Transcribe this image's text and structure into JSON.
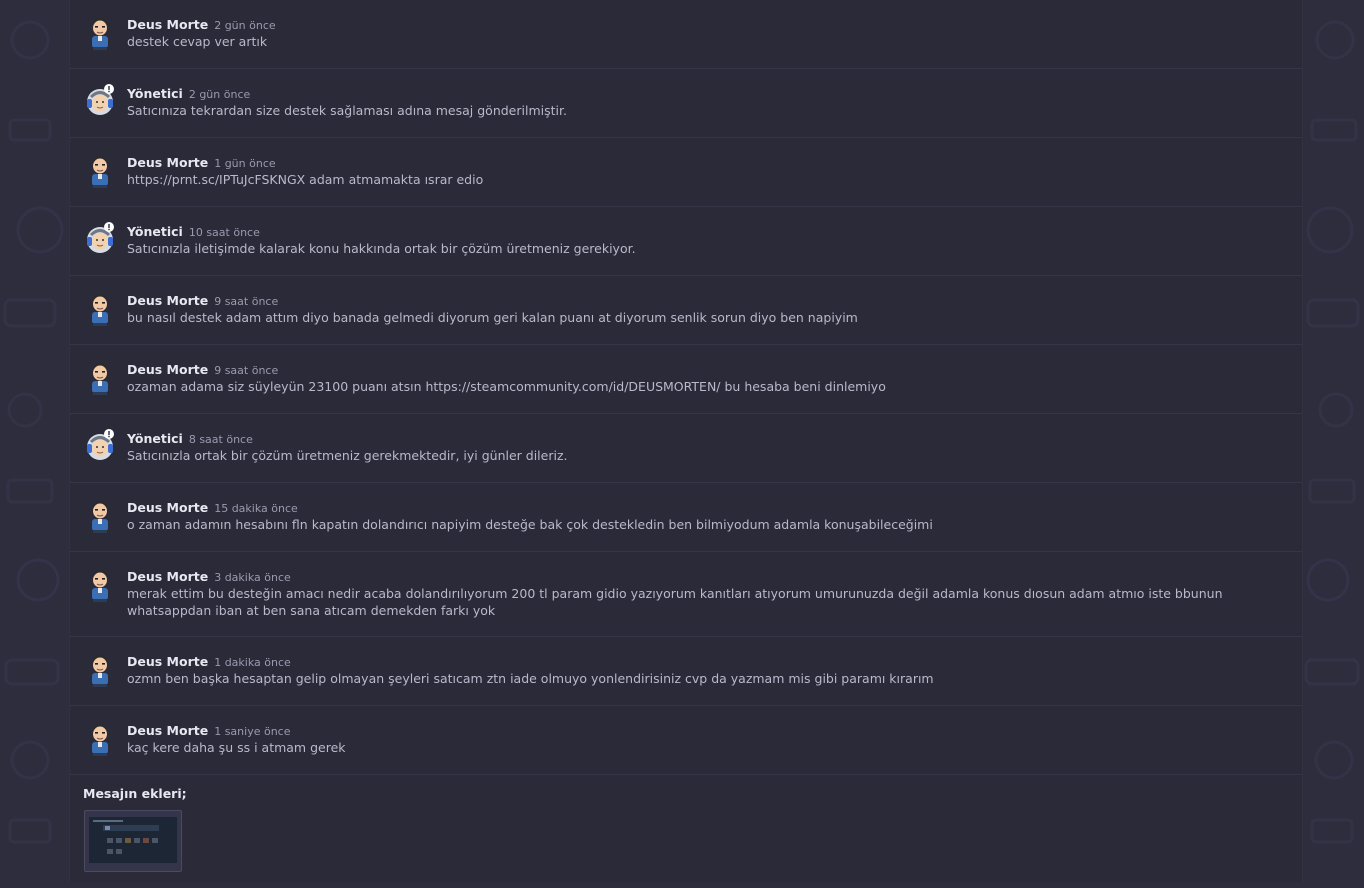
{
  "messages": [
    {
      "author": "Deus Morte",
      "time": "2 gün önce",
      "text": "destek cevap ver artık",
      "role": "user"
    },
    {
      "author": "Yönetici",
      "time": "2 gün önce",
      "text": "Satıcınıza tekrardan size destek sağlaması adına mesaj gönderilmiştir.",
      "role": "admin"
    },
    {
      "author": "Deus Morte",
      "time": "1 gün önce",
      "text": "https://prnt.sc/IPTuJcFSKNGX adam atmamakta ısrar edio",
      "role": "user"
    },
    {
      "author": "Yönetici",
      "time": "10 saat önce",
      "text": "Satıcınızla iletişimde kalarak konu hakkında ortak bir çözüm üretmeniz gerekiyor.",
      "role": "admin"
    },
    {
      "author": "Deus Morte",
      "time": "9 saat önce",
      "text": "bu nasıl destek adam attım diyo banada gelmedi diyorum geri kalan puanı at diyorum senlik sorun diyo ben napiyim",
      "role": "user"
    },
    {
      "author": "Deus Morte",
      "time": "9 saat önce",
      "text": "ozaman adama siz süyleyün 23100 puanı atsın https://steamcommunity.com/id/DEUSMORTEN/ bu hesaba beni dinlemiyo",
      "role": "user"
    },
    {
      "author": "Yönetici",
      "time": "8 saat önce",
      "text": "Satıcınızla ortak bir çözüm üretmeniz gerekmektedir, iyi günler dileriz.",
      "role": "admin"
    },
    {
      "author": "Deus Morte",
      "time": "15 dakika önce",
      "text": "o zaman adamın hesabını fln kapatın dolandırıcı napiyim desteğe bak çok destekledin ben bilmiyodum adamla konuşabileceğimi",
      "role": "user"
    },
    {
      "author": "Deus Morte",
      "time": "3 dakika önce",
      "text": "merak ettim bu desteğin amacı nedir acaba dolandırılıyorum 200 tl param gidio yazıyorum kanıtları atıyorum umurunuzda değil adamla konus dıosun adam atmıo iste bbunun whatsappdan iban at ben sana atıcam demekden farkı yok",
      "role": "user"
    },
    {
      "author": "Deus Morte",
      "time": "1 dakika önce",
      "text": "ozmn ben başka hesaptan gelip olmayan şeyleri satıcam ztn iade olmuyo yonlendirisiniz cvp da yazmam mis gibi paramı kırarım",
      "role": "user"
    },
    {
      "author": "Deus Morte",
      "time": "1 saniye önce",
      "text": "kaç kere daha şu ss i atmam gerek",
      "role": "user"
    }
  ],
  "attachments": {
    "title": "Mesajın ekleri;"
  },
  "colors": {
    "background": "#2d2d3d",
    "panel": "#2a2a38",
    "author": "#e8e8f2",
    "text": "#b9b9cc",
    "time": "#9a9ab0"
  }
}
